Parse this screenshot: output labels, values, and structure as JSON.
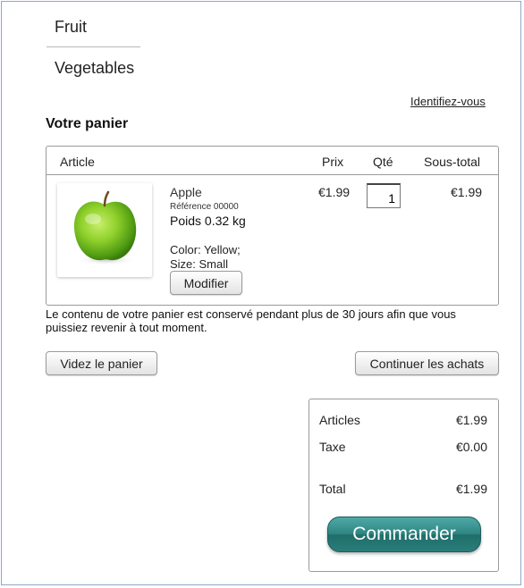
{
  "nav": {
    "fruit": "Fruit",
    "vegetables": "Vegetables"
  },
  "login_link": "Identifiez-vous",
  "cart": {
    "title": "Votre panier",
    "headers": {
      "article": "Article",
      "price": "Prix",
      "qty": "Qté",
      "subtotal": "Sous-total"
    },
    "item": {
      "image_icon": "green-apple-photo",
      "name": "Apple",
      "reference": "Référence 00000",
      "weight": "Poids 0.32 kg",
      "color": "Color: Yellow;",
      "size": "Size: Small",
      "modify_label": "Modifier",
      "price": "€1.99",
      "quantity": "1",
      "subtotal": "€1.99"
    },
    "notice": "Le contenu de votre panier est conservé pendant plus de 30 jours afin que vous puissiez revenir à tout moment.",
    "empty_label": "Videz le panier",
    "continue_label": "Continuer les achats"
  },
  "summary": {
    "articles_label": "Articles",
    "articles_value": "€1.99",
    "tax_label": "Taxe",
    "tax_value": "€0.00",
    "total_label": "Total",
    "total_value": "€1.99",
    "checkout_label": "Commander"
  },
  "colors": {
    "border": "#8fa9c8",
    "checkout": "#2f8683"
  }
}
